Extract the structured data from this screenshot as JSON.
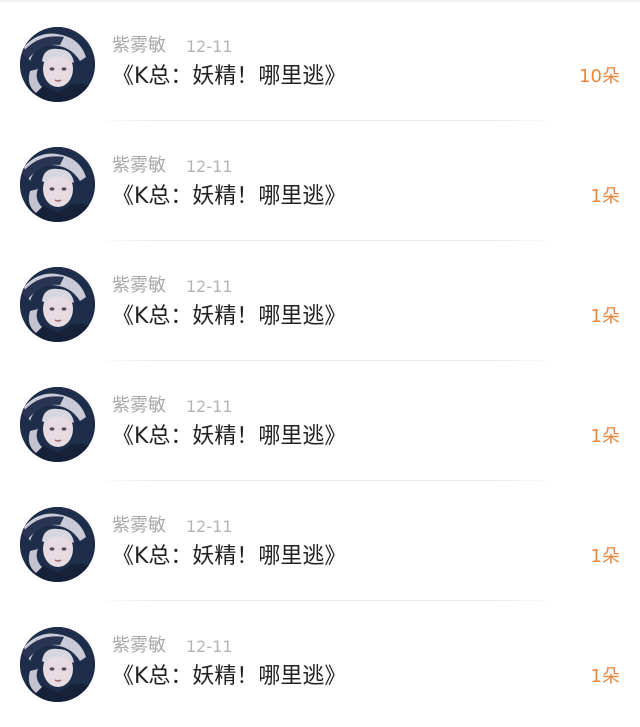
{
  "gifts": [
    {
      "user": "紫雾敏",
      "date": "12-11",
      "title": "《K总：妖精！哪里逃》",
      "count": "10朵"
    },
    {
      "user": "紫雾敏",
      "date": "12-11",
      "title": "《K总：妖精！哪里逃》",
      "count": "1朵"
    },
    {
      "user": "紫雾敏",
      "date": "12-11",
      "title": "《K总：妖精！哪里逃》",
      "count": "1朵"
    },
    {
      "user": "紫雾敏",
      "date": "12-11",
      "title": "《K总：妖精！哪里逃》",
      "count": "1朵"
    },
    {
      "user": "紫雾敏",
      "date": "12-11",
      "title": "《K总：妖精！哪里逃》",
      "count": "1朵"
    },
    {
      "user": "紫雾敏",
      "date": "12-11",
      "title": "《K总：妖精！哪里逃》",
      "count": "1朵"
    }
  ],
  "colors": {
    "count": "#e9863b",
    "name": "#a9a9a9",
    "title": "#222222"
  }
}
